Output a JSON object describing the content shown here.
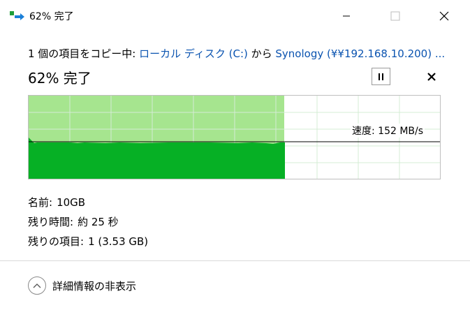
{
  "window": {
    "title": "62% 完了",
    "icon": "file-copy-icon"
  },
  "copy_info": {
    "prefix": "1 個の項目をコピー中: ",
    "source": "ローカル ディスク (C:)",
    "middle": " から ",
    "destination": "Synology (¥¥192.168.10.200) ..."
  },
  "progress": {
    "heading": "62% 完了",
    "percent": 62,
    "speed_label": "速度: 152 MB/s"
  },
  "details": {
    "name_label": "名前:",
    "name_value": "10GB",
    "time_label": "残り時間:",
    "time_value": "約 25 秒",
    "items_label": "残りの項目:",
    "items_value": "1 (3.53 GB)"
  },
  "footer": {
    "toggle_label": "詳細情報の非表示"
  },
  "colors": {
    "light_fill": "#a6e58f",
    "dark_fill": "#06b025",
    "grid": "#cfe8cf",
    "link": "#0a53b0"
  }
}
